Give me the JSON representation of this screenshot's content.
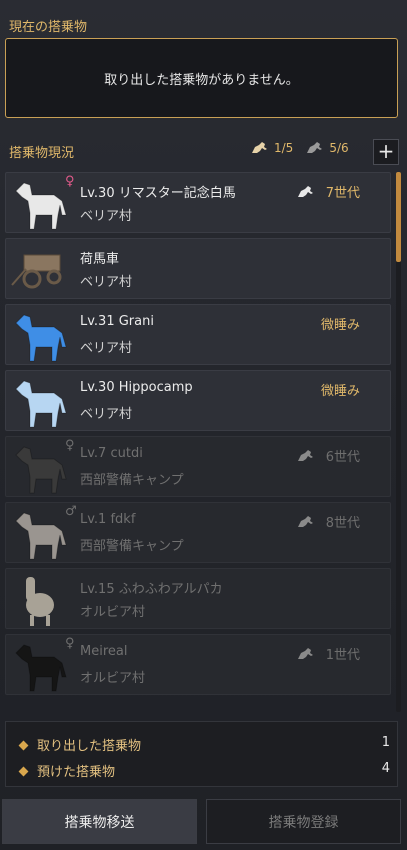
{
  "current_section": {
    "title": "現在の搭乗物",
    "empty_message": "取り出した搭乗物がありません。"
  },
  "status_section": {
    "title": "搭乗物現況",
    "count_out": "1/5",
    "count_stored": "5/6",
    "add_symbol": "+"
  },
  "mounts": [
    {
      "gender": "♀",
      "name": "Lv.30 リマスター記念白馬",
      "location": "ベリア村",
      "generation": "7世代",
      "state": "",
      "dim": false,
      "kind": "white-horse"
    },
    {
      "gender": "",
      "name": "荷馬車",
      "location": "ベリア村",
      "generation": "",
      "state": "",
      "dim": false,
      "kind": "wagon"
    },
    {
      "gender": "",
      "name": "Lv.31 Grani",
      "location": "ベリア村",
      "generation": "",
      "state": "微睡み",
      "dim": false,
      "kind": "blue-horse"
    },
    {
      "gender": "",
      "name": "Lv.30 Hippocamp",
      "location": "ベリア村",
      "generation": "",
      "state": "微睡み",
      "dim": false,
      "kind": "sea-horse"
    },
    {
      "gender": "♀",
      "name": "Lv.7 cutdi",
      "location": "西部警備キャンプ",
      "generation": "6世代",
      "state": "",
      "dim": true,
      "kind": "dark-horse"
    },
    {
      "gender": "♂",
      "name": "Lv.1 fdkf",
      "location": "西部警備キャンプ",
      "generation": "8世代",
      "state": "",
      "dim": true,
      "kind": "grey-horse"
    },
    {
      "gender": "",
      "name": "Lv.15 ふわふわアルパカ",
      "location": "オルビア村",
      "generation": "",
      "state": "",
      "dim": true,
      "kind": "alpaca"
    },
    {
      "gender": "♀",
      "name": "Meireal",
      "location": "オルビア村",
      "generation": "1世代",
      "state": "",
      "dim": true,
      "kind": "black-horse"
    }
  ],
  "summary": {
    "items": [
      {
        "label": "取り出した搭乗物",
        "value": "1"
      },
      {
        "label": "預けた搭乗物",
        "value": "4"
      }
    ]
  },
  "buttons": {
    "transfer": "搭乗物移送",
    "register": "搭乗物登録"
  },
  "colors": {
    "accent": "#e0b86a",
    "border_gold": "#c9a055",
    "scroll": "#c28a3f"
  }
}
